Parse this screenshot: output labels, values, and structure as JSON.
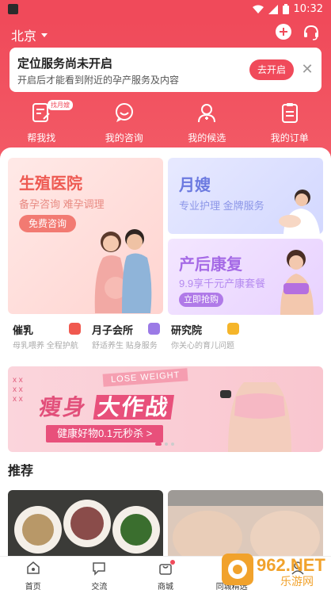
{
  "status_bar": {
    "time": "10:32"
  },
  "header": {
    "city": "北京"
  },
  "notice": {
    "title": "定位服务尚未开启",
    "subtitle": "开启后才能看到附近的孕产服务及内容",
    "button": "去开启"
  },
  "quick_actions": [
    {
      "label": "帮我找",
      "badge": "找月嫂"
    },
    {
      "label": "我的咨询"
    },
    {
      "label": "我的候选"
    },
    {
      "label": "我的订单"
    }
  ],
  "cards": {
    "hospital": {
      "title": "生殖医院",
      "desc": "备孕咨询 难孕调理",
      "button": "免费咨询"
    },
    "yuesao": {
      "title": "月嫂",
      "desc": "专业护理 金牌服务"
    },
    "postnatal": {
      "title": "产后康复",
      "desc": "9.9享千元产康套餐",
      "button": "立即抢购"
    }
  },
  "services": [
    {
      "title": "催乳",
      "desc": "母乳喂养 全程护航"
    },
    {
      "title": "月子会所",
      "desc": "舒适养生 贴身服务"
    },
    {
      "title": "研究院",
      "desc": "你关心的育儿问题"
    }
  ],
  "banner": {
    "tag": "LOSE WEIGHT",
    "headline_a": "瘦身",
    "headline_b": "大作战",
    "deal": "健康好物0.1元秒杀 >"
  },
  "recommend": {
    "title": "推荐"
  },
  "tabbar": [
    {
      "label": "首页"
    },
    {
      "label": "交流"
    },
    {
      "label": "商城"
    },
    {
      "label": "同城精选"
    }
  ],
  "watermark": {
    "text": "962.NET",
    "sub": "乐游网"
  },
  "colors": {
    "primary": "#f04a5a",
    "hospital": "#ee5a52",
    "yuesao": "#6c7ae0",
    "postnatal": "#a56ae6",
    "banner": "#e8507b"
  }
}
